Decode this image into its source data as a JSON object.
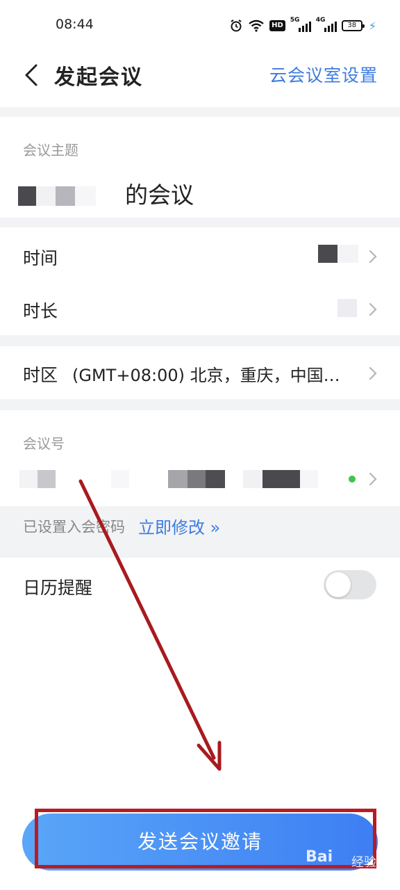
{
  "status_bar": {
    "time": "08:44",
    "hd_label": "HD",
    "network1": "5G",
    "network2": "4G",
    "battery": "38",
    "icons": [
      "alarm-icon",
      "wifi-icon",
      "hd-icon",
      "signal-5g-icon",
      "signal-4g-icon",
      "battery-icon",
      "charging-icon"
    ]
  },
  "header": {
    "title": "发起会议",
    "settings_link": "云会议室设置"
  },
  "topic": {
    "label": "会议主题",
    "value_suffix": "的会议"
  },
  "rows": {
    "time_label": "时间",
    "duration_label": "时长",
    "timezone_label": "时区",
    "timezone_value": "(GMT+08:00) 北京，重庆，中国…"
  },
  "meeting_number": {
    "label": "会议号"
  },
  "password": {
    "status": "已设置入会密码",
    "modify_link": "立即修改 »"
  },
  "calendar": {
    "label": "日历提醒",
    "enabled": false
  },
  "send_button": {
    "label": "发送会议邀请"
  },
  "watermark": {
    "brand": "Bai",
    "suffix": "经验"
  },
  "colors": {
    "accent": "#3d7be0",
    "button_start": "#5aa6f8",
    "button_end": "#3d7ef3",
    "annotation_red": "#b81c22",
    "divider": "#f2f3f5",
    "status_dot": "#3fc54a"
  }
}
